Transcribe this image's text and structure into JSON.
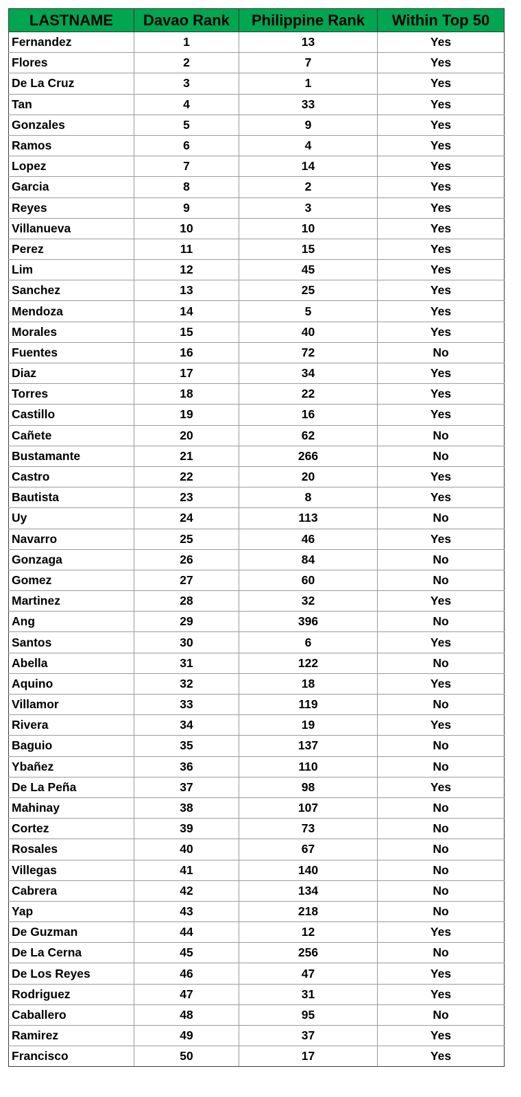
{
  "table": {
    "headers": [
      "LASTNAME",
      "Davao Rank",
      "Philippine Rank",
      "Within Top 50"
    ],
    "rows": [
      [
        "Fernandez",
        "1",
        "13",
        "Yes"
      ],
      [
        "Flores",
        "2",
        "7",
        "Yes"
      ],
      [
        "De La Cruz",
        "3",
        "1",
        "Yes"
      ],
      [
        "Tan",
        "4",
        "33",
        "Yes"
      ],
      [
        "Gonzales",
        "5",
        "9",
        "Yes"
      ],
      [
        "Ramos",
        "6",
        "4",
        "Yes"
      ],
      [
        "Lopez",
        "7",
        "14",
        "Yes"
      ],
      [
        "Garcia",
        "8",
        "2",
        "Yes"
      ],
      [
        "Reyes",
        "9",
        "3",
        "Yes"
      ],
      [
        "Villanueva",
        "10",
        "10",
        "Yes"
      ],
      [
        "Perez",
        "11",
        "15",
        "Yes"
      ],
      [
        "Lim",
        "12",
        "45",
        "Yes"
      ],
      [
        "Sanchez",
        "13",
        "25",
        "Yes"
      ],
      [
        "Mendoza",
        "14",
        "5",
        "Yes"
      ],
      [
        "Morales",
        "15",
        "40",
        "Yes"
      ],
      [
        "Fuentes",
        "16",
        "72",
        "No"
      ],
      [
        "Diaz",
        "17",
        "34",
        "Yes"
      ],
      [
        "Torres",
        "18",
        "22",
        "Yes"
      ],
      [
        "Castillo",
        "19",
        "16",
        "Yes"
      ],
      [
        "Cañete",
        "20",
        "62",
        "No"
      ],
      [
        "Bustamante",
        "21",
        "266",
        "No"
      ],
      [
        "Castro",
        "22",
        "20",
        "Yes"
      ],
      [
        "Bautista",
        "23",
        "8",
        "Yes"
      ],
      [
        "Uy",
        "24",
        "113",
        "No"
      ],
      [
        "Navarro",
        "25",
        "46",
        "Yes"
      ],
      [
        "Gonzaga",
        "26",
        "84",
        "No"
      ],
      [
        "Gomez",
        "27",
        "60",
        "No"
      ],
      [
        "Martinez",
        "28",
        "32",
        "Yes"
      ],
      [
        "Ang",
        "29",
        "396",
        "No"
      ],
      [
        "Santos",
        "30",
        "6",
        "Yes"
      ],
      [
        "Abella",
        "31",
        "122",
        "No"
      ],
      [
        "Aquino",
        "32",
        "18",
        "Yes"
      ],
      [
        "Villamor",
        "33",
        "119",
        "No"
      ],
      [
        "Rivera",
        "34",
        "19",
        "Yes"
      ],
      [
        "Baguio",
        "35",
        "137",
        "No"
      ],
      [
        "Ybañez",
        "36",
        "110",
        "No"
      ],
      [
        "De La Peña",
        "37",
        "98",
        "Yes"
      ],
      [
        "Mahinay",
        "38",
        "107",
        "No"
      ],
      [
        "Cortez",
        "39",
        "73",
        "No"
      ],
      [
        "Rosales",
        "40",
        "67",
        "No"
      ],
      [
        "Villegas",
        "41",
        "140",
        "No"
      ],
      [
        "Cabrera",
        "42",
        "134",
        "No"
      ],
      [
        "Yap",
        "43",
        "218",
        "No"
      ],
      [
        "De Guzman",
        "44",
        "12",
        "Yes"
      ],
      [
        "De La Cerna",
        "45",
        "256",
        "No"
      ],
      [
        "De Los Reyes",
        "46",
        "47",
        "Yes"
      ],
      [
        "Rodriguez",
        "47",
        "31",
        "Yes"
      ],
      [
        "Caballero",
        "48",
        "95",
        "No"
      ],
      [
        "Ramirez",
        "49",
        "37",
        "Yes"
      ],
      [
        "Francisco",
        "50",
        "17",
        "Yes"
      ]
    ]
  },
  "colors": {
    "header_bg": "#00a650"
  }
}
